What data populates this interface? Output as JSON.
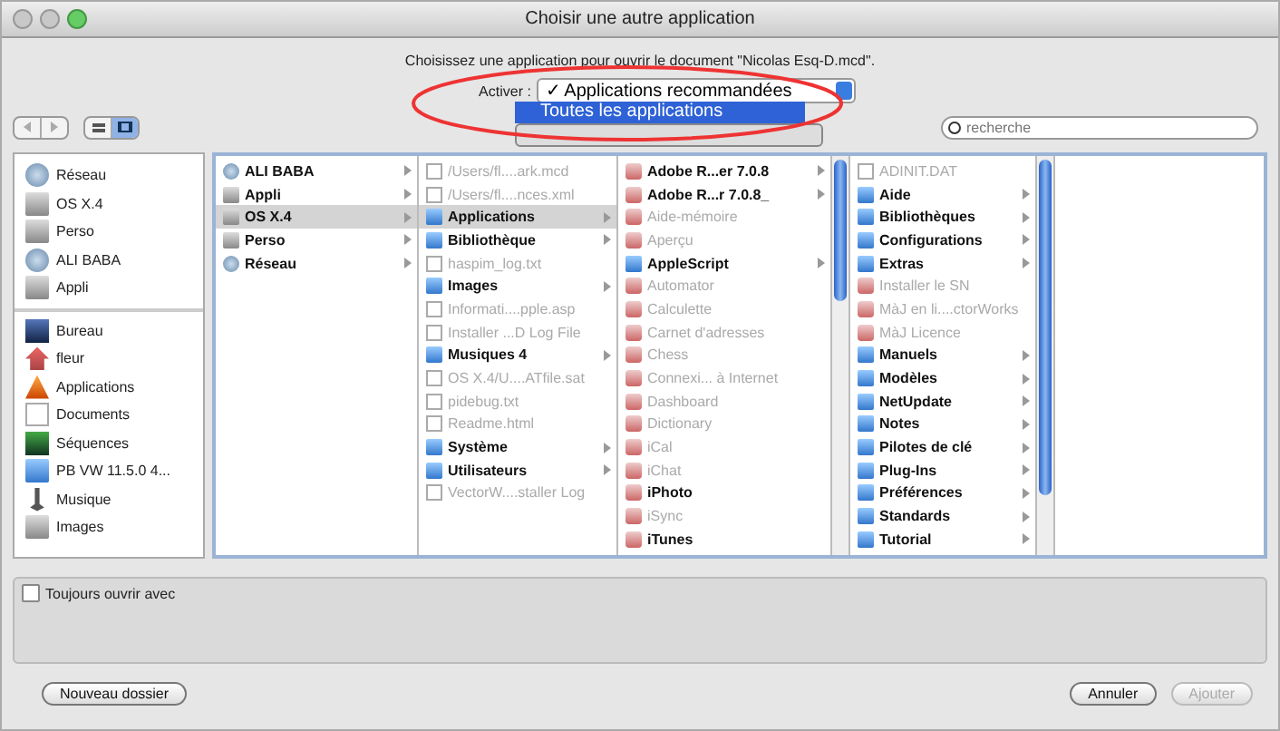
{
  "window": {
    "title": "Choisir une autre application"
  },
  "message": "Choisissez une application pour ouvrir le document \"Nicolas Esq-D.mcd\".",
  "enable": {
    "label": "Activer :",
    "value": "✓ Applications recommandées",
    "menu": [
      {
        "label": "Toutes les applications",
        "selected": true
      }
    ]
  },
  "toolbar": {
    "views": [
      {
        "kind": "list",
        "selected": false
      },
      {
        "kind": "columns",
        "selected": true
      }
    ],
    "search": {
      "placeholder": "recherche"
    }
  },
  "sidebar": {
    "groups": [
      [
        {
          "label": "Réseau",
          "kind": "network"
        },
        {
          "label": "OS X.4",
          "kind": "disk"
        },
        {
          "label": "Perso",
          "kind": "disk"
        },
        {
          "label": "ALI BABA",
          "kind": "network"
        },
        {
          "label": "Appli",
          "kind": "disk"
        }
      ],
      [
        {
          "label": "Bureau",
          "kind": "desktop"
        },
        {
          "label": "fleur",
          "kind": "home"
        },
        {
          "label": "Applications",
          "kind": "apps"
        },
        {
          "label": "Documents",
          "kind": "file"
        },
        {
          "label": "Séquences",
          "kind": "movies"
        },
        {
          "label": "PB VW 11.5.0 4...",
          "kind": "folder"
        },
        {
          "label": "Musique",
          "kind": "music"
        },
        {
          "label": "Images",
          "kind": "disk"
        }
      ]
    ]
  },
  "columns": [
    [
      {
        "name": "ALI BABA",
        "kind": "network",
        "arrow": true,
        "dim": false,
        "selected": false
      },
      {
        "name": "Appli",
        "kind": "disk",
        "arrow": true,
        "dim": false,
        "selected": false
      },
      {
        "name": "OS X.4",
        "kind": "disk",
        "arrow": true,
        "dim": false,
        "selected": true
      },
      {
        "name": "Perso",
        "kind": "disk",
        "arrow": true,
        "dim": false,
        "selected": false
      },
      {
        "name": "Réseau",
        "kind": "network",
        "arrow": true,
        "dim": false,
        "selected": false
      }
    ],
    [
      {
        "name": "/Users/fl....ark.mcd",
        "kind": "file",
        "arrow": false,
        "dim": true,
        "selected": false
      },
      {
        "name": "/Users/fl....nces.xml",
        "kind": "file",
        "arrow": false,
        "dim": true,
        "selected": false
      },
      {
        "name": "Applications",
        "kind": "folder",
        "arrow": true,
        "dim": false,
        "selected": true
      },
      {
        "name": "Bibliothèque",
        "kind": "folder",
        "arrow": true,
        "dim": false,
        "selected": false
      },
      {
        "name": "haspim_log.txt",
        "kind": "file",
        "arrow": false,
        "dim": true,
        "selected": false
      },
      {
        "name": "Images",
        "kind": "folder",
        "arrow": true,
        "dim": false,
        "selected": false
      },
      {
        "name": "Informati....pple.asp",
        "kind": "file",
        "arrow": false,
        "dim": true,
        "selected": false
      },
      {
        "name": "Installer ...D Log File",
        "kind": "file",
        "arrow": false,
        "dim": true,
        "selected": false
      },
      {
        "name": "Musiques 4",
        "kind": "folder",
        "arrow": true,
        "dim": false,
        "selected": false
      },
      {
        "name": "OS X.4/U....ATfile.sat",
        "kind": "file",
        "arrow": false,
        "dim": true,
        "selected": false
      },
      {
        "name": "pidebug.txt",
        "kind": "file",
        "arrow": false,
        "dim": true,
        "selected": false
      },
      {
        "name": "Readme.html",
        "kind": "file",
        "arrow": false,
        "dim": true,
        "selected": false
      },
      {
        "name": "Système",
        "kind": "folder",
        "arrow": true,
        "dim": false,
        "selected": false
      },
      {
        "name": "Utilisateurs",
        "kind": "folder",
        "arrow": true,
        "dim": false,
        "selected": false
      },
      {
        "name": "VectorW....staller Log",
        "kind": "file",
        "arrow": false,
        "dim": true,
        "selected": false
      }
    ],
    [
      {
        "name": "Adobe R...er 7.0.8",
        "kind": "app",
        "arrow": true,
        "dim": false,
        "selected": false
      },
      {
        "name": "Adobe R...r 7.0.8_",
        "kind": "app",
        "arrow": true,
        "dim": false,
        "selected": false
      },
      {
        "name": "Aide-mémoire",
        "kind": "app",
        "arrow": false,
        "dim": true,
        "selected": false
      },
      {
        "name": "Aperçu",
        "kind": "app",
        "arrow": false,
        "dim": true,
        "selected": false
      },
      {
        "name": "AppleScript",
        "kind": "folder",
        "arrow": true,
        "dim": false,
        "selected": false
      },
      {
        "name": "Automator",
        "kind": "app",
        "arrow": false,
        "dim": true,
        "selected": false
      },
      {
        "name": "Calculette",
        "kind": "app",
        "arrow": false,
        "dim": true,
        "selected": false
      },
      {
        "name": "Carnet d'adresses",
        "kind": "app",
        "arrow": false,
        "dim": true,
        "selected": false
      },
      {
        "name": "Chess",
        "kind": "app",
        "arrow": false,
        "dim": true,
        "selected": false
      },
      {
        "name": "Connexi... à Internet",
        "kind": "app",
        "arrow": false,
        "dim": true,
        "selected": false
      },
      {
        "name": "Dashboard",
        "kind": "app",
        "arrow": false,
        "dim": true,
        "selected": false
      },
      {
        "name": "Dictionary",
        "kind": "app",
        "arrow": false,
        "dim": true,
        "selected": false
      },
      {
        "name": "iCal",
        "kind": "app",
        "arrow": false,
        "dim": true,
        "selected": false
      },
      {
        "name": "iChat",
        "kind": "app",
        "arrow": false,
        "dim": true,
        "selected": false
      },
      {
        "name": "iPhoto",
        "kind": "app",
        "arrow": false,
        "dim": false,
        "selected": false
      },
      {
        "name": "iSync",
        "kind": "app",
        "arrow": false,
        "dim": true,
        "selected": false
      },
      {
        "name": "iTunes",
        "kind": "app",
        "arrow": false,
        "dim": false,
        "selected": false
      }
    ],
    [
      {
        "name": "ADINIT.DAT",
        "kind": "file",
        "arrow": false,
        "dim": true,
        "selected": false
      },
      {
        "name": "Aide",
        "kind": "folder",
        "arrow": true,
        "dim": false,
        "selected": false
      },
      {
        "name": "Bibliothèques",
        "kind": "folder",
        "arrow": true,
        "dim": false,
        "selected": false
      },
      {
        "name": "Configurations",
        "kind": "folder",
        "arrow": true,
        "dim": false,
        "selected": false
      },
      {
        "name": "Extras",
        "kind": "folder",
        "arrow": true,
        "dim": false,
        "selected": false
      },
      {
        "name": "Installer le SN",
        "kind": "app",
        "arrow": false,
        "dim": true,
        "selected": false
      },
      {
        "name": "MàJ en li....ctorWorks",
        "kind": "app",
        "arrow": false,
        "dim": true,
        "selected": false
      },
      {
        "name": "MàJ Licence",
        "kind": "app",
        "arrow": false,
        "dim": true,
        "selected": false
      },
      {
        "name": "Manuels",
        "kind": "folder",
        "arrow": true,
        "dim": false,
        "selected": false
      },
      {
        "name": "Modèles",
        "kind": "folder",
        "arrow": true,
        "dim": false,
        "selected": false
      },
      {
        "name": "NetUpdate",
        "kind": "folder",
        "arrow": true,
        "dim": false,
        "selected": false
      },
      {
        "name": "Notes",
        "kind": "folder",
        "arrow": true,
        "dim": false,
        "selected": false
      },
      {
        "name": "Pilotes de clé",
        "kind": "folder",
        "arrow": true,
        "dim": false,
        "selected": false
      },
      {
        "name": "Plug-Ins",
        "kind": "folder",
        "arrow": true,
        "dim": false,
        "selected": false
      },
      {
        "name": "Préférences",
        "kind": "folder",
        "arrow": true,
        "dim": false,
        "selected": false
      },
      {
        "name": "Standards",
        "kind": "folder",
        "arrow": true,
        "dim": false,
        "selected": false
      },
      {
        "name": "Tutorial",
        "kind": "folder",
        "arrow": true,
        "dim": false,
        "selected": false
      }
    ]
  ],
  "always_open": {
    "label": "Toujours ouvrir avec",
    "checked": false
  },
  "buttons": [
    {
      "label": "Nouveau dossier",
      "kind": "left",
      "disabled": false
    },
    {
      "label": "Annuler",
      "kind": "right",
      "disabled": false
    },
    {
      "label": "Ajouter",
      "kind": "right",
      "disabled": true
    }
  ]
}
